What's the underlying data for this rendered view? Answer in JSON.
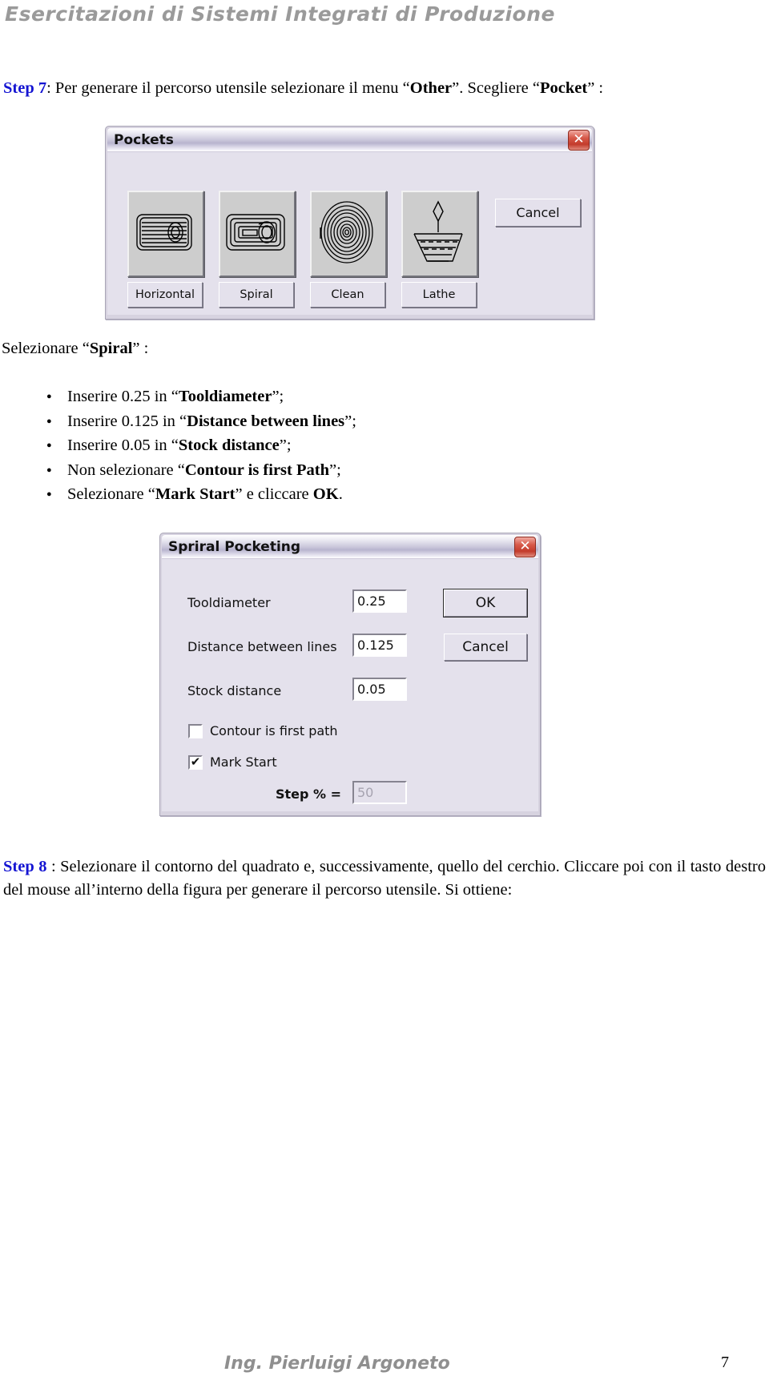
{
  "header": {
    "title": "Esercitazioni di Sistemi Integrati di Produzione"
  },
  "step7": {
    "label": "Step 7",
    "text_1": ": Per generare il percorso utensile selezionare il menu “",
    "bold_1": "Other",
    "text_2": "”. Scegliere “",
    "bold_2": "Pocket",
    "text_3": "” :"
  },
  "pockets_dialog": {
    "title": "Pockets",
    "close_label": "✕",
    "cancel_label": "Cancel",
    "buttons": [
      {
        "label": "Horizontal",
        "icon": "horizontal-pocket-icon"
      },
      {
        "label": "Spiral",
        "icon": "spiral-pocket-icon"
      },
      {
        "label": "Clean",
        "icon": "clean-pocket-icon"
      },
      {
        "label": "Lathe",
        "icon": "lathe-pocket-icon"
      }
    ]
  },
  "selezionare": {
    "text_1": "Selezionare “",
    "bold_1": "Spiral",
    "text_2": "” :"
  },
  "bullets": [
    {
      "pre": "Inserire 0.25 in “",
      "bold": "Tooldiameter",
      "post": "”;"
    },
    {
      "pre": "Inserire 0.125 in “",
      "bold": "Distance between lines",
      "post": "”;"
    },
    {
      "pre": "Inserire 0.05 in “",
      "bold": "Stock distance",
      "post": "”;"
    },
    {
      "pre": "Non selezionare “",
      "bold": "Contour is first Path",
      "post": "”;"
    },
    {
      "pre": "Selezionare “",
      "bold": "Mark Start",
      "post": "” e cliccare ",
      "bold2": "OK",
      "post2": "."
    }
  ],
  "spiral_dialog": {
    "title": "Spriral Pocketing",
    "close_label": "✕",
    "fields": [
      {
        "label": "Tooldiameter",
        "value": "0.25"
      },
      {
        "label": "Distance between lines",
        "value": "0.125"
      },
      {
        "label": "Stock distance",
        "value": "0.05"
      }
    ],
    "ok_label": "OK",
    "cancel_label": "Cancel",
    "checkboxes": [
      {
        "label": "Contour is first path",
        "checked": ""
      },
      {
        "label": "Mark Start",
        "checked": "✔"
      }
    ],
    "step_label": "Step % =",
    "step_value": "50"
  },
  "step8": {
    "label": "Step 8",
    "text": " : Selezionare il contorno del quadrato e, successivamente, quello del cerchio. Cliccare poi con il tasto destro del mouse all’interno della figura per generare il percorso utensile. Si ottiene:"
  },
  "footer": {
    "author": "Ing. Pierluigi Argoneto",
    "page": "7"
  }
}
